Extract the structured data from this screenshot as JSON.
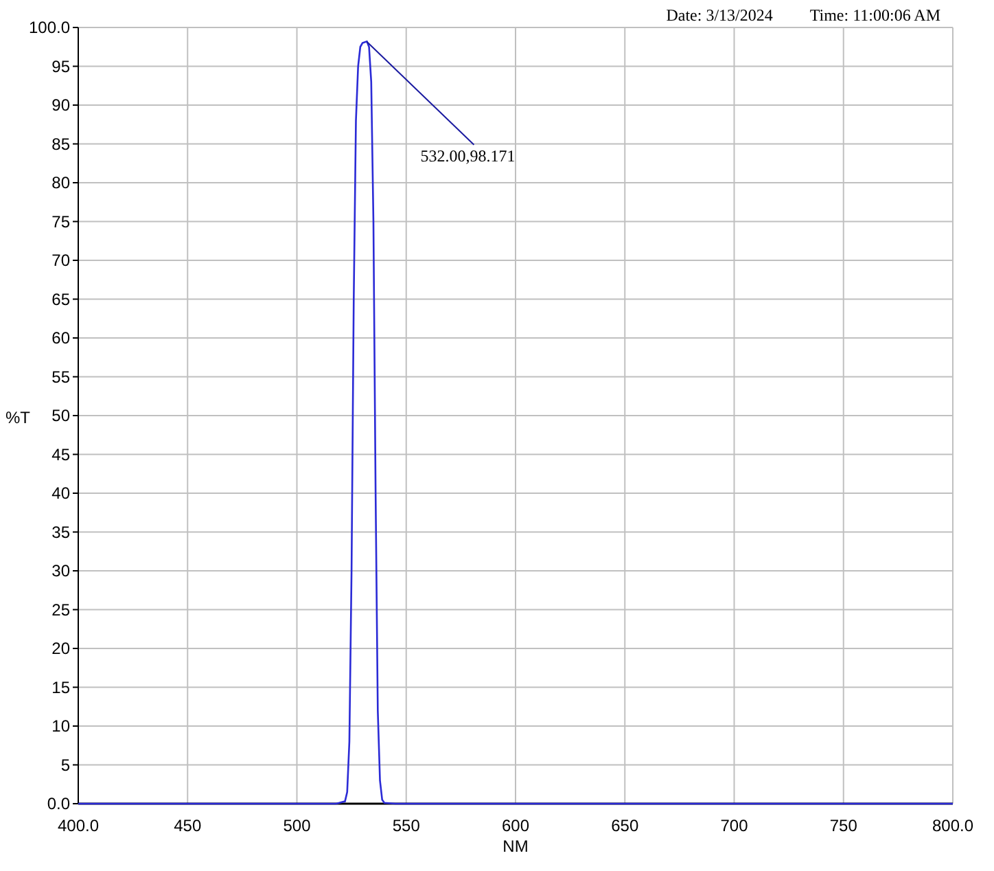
{
  "header": {
    "date": "Date: 3/13/2024",
    "time": "Time: 11:00:06 AM"
  },
  "chart_data": {
    "type": "line",
    "grid": true,
    "xlabel": "NM",
    "ylabel": "%T",
    "xlim": [
      400,
      800
    ],
    "ylim": [
      0,
      100
    ],
    "x": [
      400,
      518,
      522,
      523,
      524,
      525,
      526,
      527,
      528,
      529,
      530,
      532,
      533,
      534,
      535,
      536,
      537,
      538,
      539,
      540,
      545,
      800
    ],
    "series": [
      {
        "color": "#2b2bd6",
        "values": [
          0,
          0,
          0.3,
          1.5,
          8,
          30,
          65,
          88,
          95,
          97.5,
          98,
          98.2,
          97.5,
          93,
          75,
          40,
          12,
          3,
          0.5,
          0.1,
          0,
          0
        ]
      }
    ],
    "xticks": [
      {
        "value": 400,
        "label": "400.0"
      },
      450,
      500,
      550,
      600,
      650,
      700,
      750,
      {
        "value": 800,
        "label": "800.0"
      }
    ],
    "yticks": [
      {
        "value": 0,
        "label": "0.0"
      },
      5,
      10,
      15,
      20,
      25,
      30,
      35,
      40,
      45,
      50,
      55,
      60,
      65,
      70,
      75,
      80,
      85,
      90,
      95,
      {
        "value": 100,
        "label": "100.0"
      }
    ],
    "annotations": [
      {
        "text": "532.00,98.171",
        "x": 532,
        "y": 98.171
      }
    ]
  }
}
